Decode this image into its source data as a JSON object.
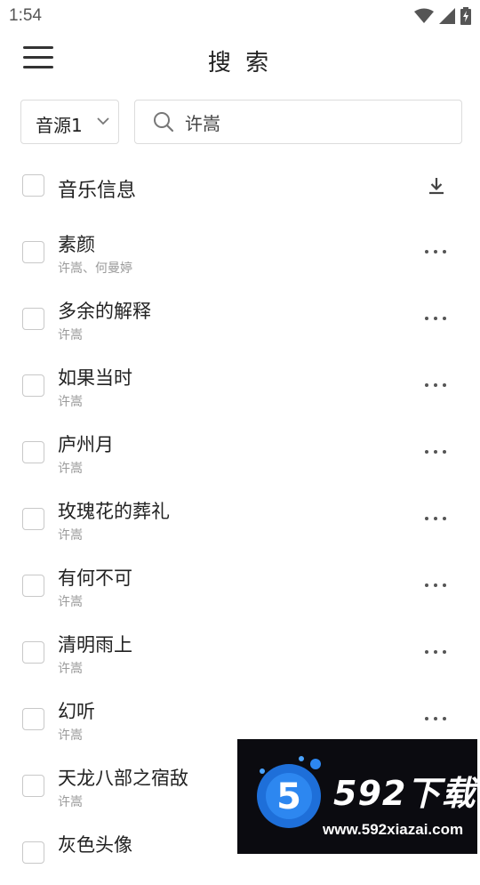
{
  "status_bar": {
    "time": "1:54",
    "icons": [
      "wifi-icon",
      "signal-icon",
      "battery-charging-icon"
    ]
  },
  "app_bar": {
    "menu_icon": "hamburger-menu-icon",
    "title": "搜 索"
  },
  "search": {
    "source_label": "音源1",
    "source_icon": "chevron-down-icon",
    "query": "许嵩",
    "search_icon": "search-icon"
  },
  "list_header": {
    "label": "音乐信息",
    "download_icon": "download-icon"
  },
  "songs": [
    {
      "title": "素颜",
      "artist": "许嵩、何曼婷"
    },
    {
      "title": "多余的解释",
      "artist": "许嵩"
    },
    {
      "title": "如果当时",
      "artist": "许嵩"
    },
    {
      "title": "庐州月",
      "artist": "许嵩"
    },
    {
      "title": "玫瑰花的葬礼",
      "artist": "许嵩"
    },
    {
      "title": "有何不可",
      "artist": "许嵩"
    },
    {
      "title": "清明雨上",
      "artist": "许嵩"
    },
    {
      "title": "幻听",
      "artist": "许嵩"
    },
    {
      "title": "天龙八部之宿敌",
      "artist": "许嵩"
    },
    {
      "title": "灰色头像",
      "artist": ""
    }
  ],
  "watermark": {
    "brand": "592下载",
    "url": "www.592xiazai.com",
    "logo_text": "5"
  },
  "colors": {
    "text_primary": "#222222",
    "text_secondary": "#9a9a9a",
    "border": "#dcdcdc",
    "watermark_bg": "#0b0b10",
    "logo_blue": "#1e6fd9"
  }
}
